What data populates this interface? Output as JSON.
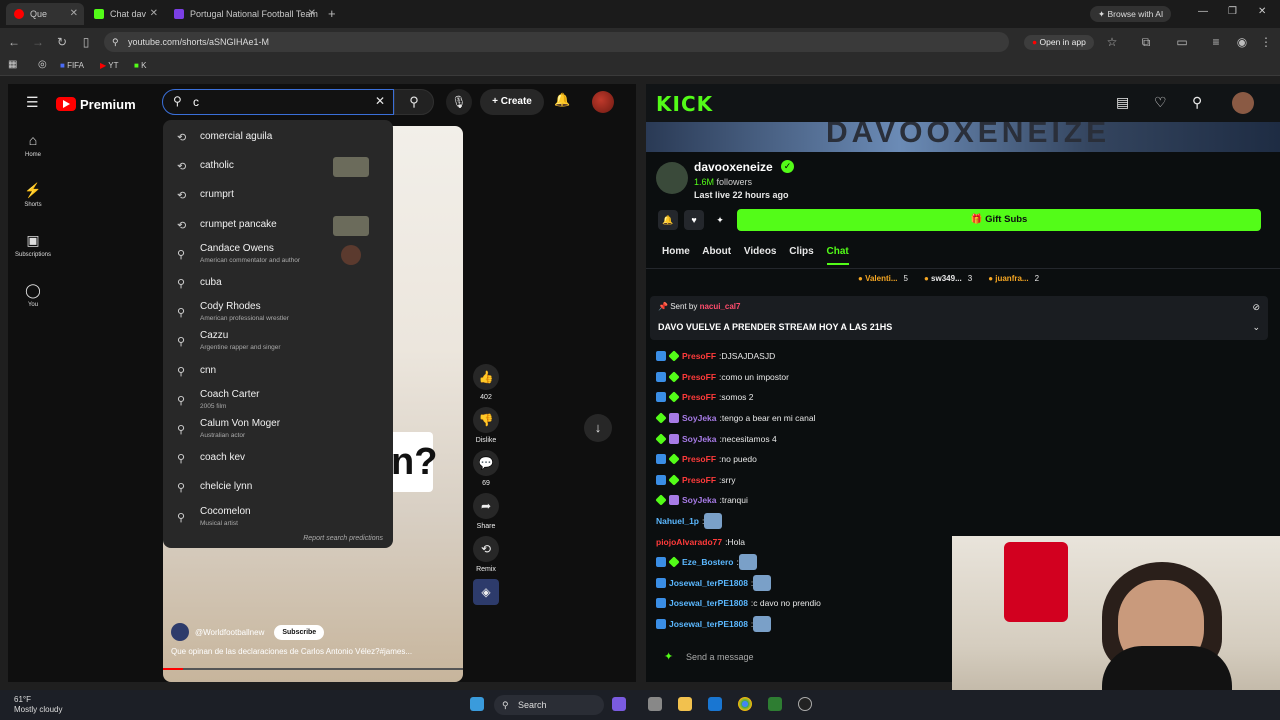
{
  "browser": {
    "tabs": [
      {
        "label": "Que ",
        "color": "#ff0000"
      },
      {
        "label": "Chat dav",
        "color": "#53fc18"
      },
      {
        "label": "Portugal National Football Team",
        "color": "#7b3fe4"
      }
    ],
    "url": "youtube.com/shorts/aSNGIHAe1-M",
    "browse_ai": "Browse with AI",
    "open_in_app": "Open in app",
    "bookmarks": [
      "FIFA",
      "YT",
      "K"
    ]
  },
  "youtube": {
    "logo_text": "Premium",
    "search_value": "c",
    "create_label": "Create",
    "sidebar": [
      {
        "label": "Home",
        "icon": "home-icon"
      },
      {
        "label": "Shorts",
        "icon": "shorts-icon"
      },
      {
        "label": "Subscriptions",
        "icon": "subscriptions-icon"
      },
      {
        "label": "You",
        "icon": "you-icon"
      }
    ],
    "suggestions": [
      {
        "text": "comercial aguila",
        "sub": "",
        "type": "history"
      },
      {
        "text": "catholic",
        "sub": "",
        "type": "history"
      },
      {
        "text": "crumprt",
        "sub": "",
        "type": "history"
      },
      {
        "text": "crumpet pancake",
        "sub": "",
        "type": "history"
      },
      {
        "text": "Candace Owens",
        "sub": "American commentator and author",
        "type": "search"
      },
      {
        "text": "cuba",
        "sub": "",
        "type": "search"
      },
      {
        "text": "Cody Rhodes",
        "sub": "American professional wrestler",
        "type": "search"
      },
      {
        "text": "Cazzu",
        "sub": "Argentine rapper and singer",
        "type": "search"
      },
      {
        "text": "cnn",
        "sub": "",
        "type": "search"
      },
      {
        "text": "Coach Carter",
        "sub": "2005 film",
        "type": "search"
      },
      {
        "text": "Calum Von Moger",
        "sub": "Australian actor",
        "type": "search"
      },
      {
        "text": "coach kev",
        "sub": "",
        "type": "search"
      },
      {
        "text": "chelcie lynn",
        "sub": "",
        "type": "search"
      },
      {
        "text": "Cocomelon",
        "sub": "Musical artist",
        "type": "search"
      }
    ],
    "report": "Report search predictions",
    "channel": "@Worldfootballnew",
    "subscribe": "Subscribe",
    "video_title": "Que opinan de las declaraciones de Carlos Antonio Vélez?#james...",
    "actions": [
      {
        "label": "402",
        "icon": "like-icon"
      },
      {
        "label": "Dislike",
        "icon": "dislike-icon"
      },
      {
        "label": "69",
        "icon": "comment-icon"
      },
      {
        "label": "Share",
        "icon": "share-icon"
      },
      {
        "label": "Remix",
        "icon": "remix-icon"
      }
    ]
  },
  "kick": {
    "logo": "KICK",
    "banner_text": "DAVOOXENEIZE",
    "channel_name": "davooxeneize",
    "followers_count": "1.6M",
    "followers_label": "followers",
    "last_live": "Last live 22 hours ago",
    "gift_subs": "Gift Subs",
    "tabs": [
      "Home",
      "About",
      "Videos",
      "Clips",
      "Chat"
    ],
    "leaders": [
      {
        "name": "Valenti...",
        "count": "5",
        "color": "#f5a623"
      },
      {
        "name": "sw349...",
        "count": "3",
        "color": "#e8e8e8"
      },
      {
        "name": "juanfra...",
        "count": "2",
        "color": "#f5a623"
      }
    ],
    "pinned_sent_by": "Sent by",
    "pinned_user": "nacui_cal7",
    "pinned_message": "DAVO VUELVE A PRENDER STREAM HOY A LAS 21HS",
    "messages": [
      {
        "user": "PresoFF",
        "text": "DJSAJDASJD",
        "color": "#ff3b3b",
        "badges": [
          "blue",
          "green"
        ]
      },
      {
        "user": "PresoFF",
        "text": "como un impostor",
        "color": "#ff3b3b",
        "badges": [
          "blue",
          "green"
        ]
      },
      {
        "user": "PresoFF",
        "text": "somos 2",
        "color": "#ff3b3b",
        "badges": [
          "blue",
          "green"
        ]
      },
      {
        "user": "SoyJeka",
        "text": "tengo a bear en mi canal",
        "color": "#a77be6",
        "badges": [
          "green",
          "purple"
        ]
      },
      {
        "user": "SoyJeka",
        "text": "necesitamos 4",
        "color": "#a77be6",
        "badges": [
          "green",
          "purple"
        ]
      },
      {
        "user": "PresoFF",
        "text": "no puedo",
        "color": "#ff3b3b",
        "badges": [
          "blue",
          "green"
        ]
      },
      {
        "user": "PresoFF",
        "text": "srry",
        "color": "#ff3b3b",
        "badges": [
          "blue",
          "green"
        ]
      },
      {
        "user": "SoyJeka",
        "text": "tranqui",
        "color": "#a77be6",
        "badges": [
          "green",
          "purple"
        ]
      },
      {
        "user": "Nahuel_1p",
        "text": "",
        "color": "#5bb8ff",
        "badges": []
      },
      {
        "user": "piojoAlvarado77",
        "text": "Hola",
        "color": "#ff3b3b",
        "badges": []
      },
      {
        "user": "Eze_Bostero",
        "text": "",
        "color": "#5bb8ff",
        "badges": [
          "blue",
          "green"
        ]
      },
      {
        "user": "Josewal_terPE1808",
        "text": "",
        "color": "#5bb8ff",
        "badges": [
          "blue"
        ]
      },
      {
        "user": "Josewal_terPE1808",
        "text": "c davo no prendio",
        "color": "#5bb8ff",
        "badges": [
          "blue"
        ]
      },
      {
        "user": "Josewal_terPE1808",
        "text": "",
        "color": "#5bb8ff",
        "badges": [
          "blue"
        ]
      }
    ],
    "send_placeholder": "Send a message"
  },
  "taskbar": {
    "temp": "61°F",
    "weather": "Mostly cloudy",
    "search": "Search"
  }
}
